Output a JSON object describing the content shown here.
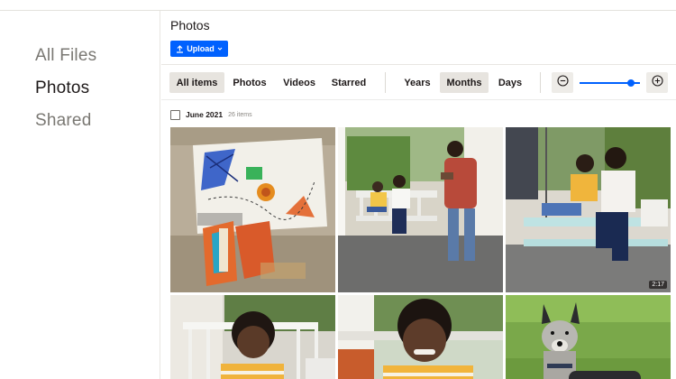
{
  "sidebar": {
    "items": [
      {
        "label": "All Files"
      },
      {
        "label": "Photos"
      },
      {
        "label": "Shared"
      }
    ]
  },
  "header": {
    "title": "Photos",
    "upload_label": "Upload"
  },
  "toolbar": {
    "filters": [
      "All items",
      "Photos",
      "Videos",
      "Starred"
    ],
    "selected_filter": "All items",
    "periods": [
      "Years",
      "Months",
      "Days"
    ],
    "selected_period": "Months",
    "zoom_out_icon": "minus-circle-icon",
    "zoom_in_icon": "plus-circle-icon",
    "zoom_level": 0.85
  },
  "group": {
    "date": "June 2021",
    "count": "26 items"
  },
  "photos": [
    {
      "subject": "collage-artwork"
    },
    {
      "subject": "man-photographing-family-on-porch-swing"
    },
    {
      "subject": "mother-and-son-on-porch-swing",
      "duration": "2:17"
    },
    {
      "subject": "smiling-boy-on-bench"
    },
    {
      "subject": "smiling-boy-closeup"
    },
    {
      "subject": "dog-on-grass"
    }
  ],
  "colors": {
    "accent": "#0061fe",
    "selected_bg": "#e7e4df",
    "text": "#1e1919",
    "muted_text": "#7a7873"
  }
}
